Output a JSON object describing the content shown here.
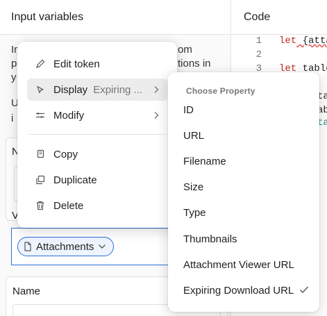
{
  "left_panel": {
    "title": "Input variables",
    "desc_lines": [
      "In",
      "p",
      "y"
    ],
    "desc_right_lines": [
      "om",
      "tions in"
    ],
    "note_lines": [
      "U",
      "i"
    ],
    "section_n": "N",
    "section_v": "V",
    "chip_label": "Attachments",
    "name_label": "Name"
  },
  "code_panel": {
    "title": "Code",
    "lines": [
      {
        "num": "1",
        "kw": "let",
        "text": " {atta"
      },
      {
        "num": "2",
        "kw": "",
        "text": ""
      },
      {
        "num": "3",
        "kw": "let",
        "text": " table"
      }
    ],
    "fragments": [
      "ta",
      "ab",
      "ta"
    ]
  },
  "context_menu": {
    "items": [
      {
        "label": "Edit token",
        "icon": "pencil-icon"
      },
      {
        "label": "Display",
        "sub": "Expiring ...",
        "icon": "eye-icon",
        "has_submenu": true,
        "active": true
      },
      {
        "label": "Modify",
        "icon": "sliders-icon",
        "has_submenu": true
      },
      {
        "label": "Copy",
        "icon": "copy-icon"
      },
      {
        "label": "Duplicate",
        "icon": "duplicate-icon"
      },
      {
        "label": "Delete",
        "icon": "trash-icon"
      }
    ]
  },
  "property_menu": {
    "title": "Choose Property",
    "options": [
      "ID",
      "URL",
      "Filename",
      "Size",
      "Type",
      "Thumbnails",
      "Attachment Viewer URL",
      "Expiring Download URL"
    ],
    "selected": "Expiring Download URL"
  },
  "colors": {
    "accent": "#2a6fdb",
    "keyword": "#c42b1c",
    "teal": "#0f8a8a"
  }
}
